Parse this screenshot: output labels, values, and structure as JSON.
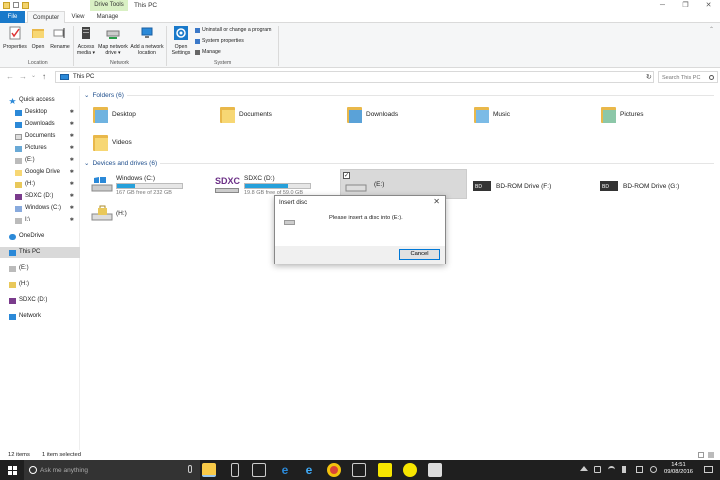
{
  "window": {
    "context_tab": "Drive Tools",
    "title": "This PC"
  },
  "ribbon_tabs": {
    "file": "File",
    "computer": "Computer",
    "view": "View",
    "manage": "Manage"
  },
  "ribbon": {
    "location": {
      "label": "Location",
      "properties": "Properties",
      "open": "Open",
      "rename": "Rename"
    },
    "network": {
      "label": "Network",
      "access_media_1": "Access",
      "access_media_2": "media ▾",
      "map_drive_1": "Map network",
      "map_drive_2": "drive ▾",
      "add_location_1": "Add a network",
      "add_location_2": "location"
    },
    "system": {
      "label": "System",
      "open_settings_1": "Open",
      "open_settings_2": "Settings",
      "uninstall": "Uninstall or change a program",
      "sys_props": "System properties",
      "manage": "Manage"
    }
  },
  "address": {
    "back": "←",
    "forward": "→",
    "recent": "⌄",
    "up": "↑",
    "path": "This PC",
    "refresh": "↻",
    "search_placeholder": "Search This PC"
  },
  "sidebar": {
    "items": [
      {
        "label": "Quick access",
        "pin": ""
      },
      {
        "label": "Desktop",
        "pin": "✱"
      },
      {
        "label": "Downloads",
        "pin": "✱"
      },
      {
        "label": "Documents",
        "pin": "✱"
      },
      {
        "label": "Pictures",
        "pin": "✱"
      },
      {
        "label": "(E:)",
        "pin": "✱"
      },
      {
        "label": "Google Drive",
        "pin": "✱"
      },
      {
        "label": "(H:)",
        "pin": "✱"
      },
      {
        "label": "SDXC (D:)",
        "pin": "✱"
      },
      {
        "label": "Windows (C:)",
        "pin": "✱"
      },
      {
        "label": "I:\\",
        "pin": "✱"
      },
      {
        "label": "OneDrive",
        "pin": ""
      },
      {
        "label": "This PC",
        "pin": ""
      },
      {
        "label": "(E:)",
        "pin": ""
      },
      {
        "label": "(H:)",
        "pin": ""
      },
      {
        "label": "SDXC (D:)",
        "pin": ""
      },
      {
        "label": "Network",
        "pin": ""
      }
    ]
  },
  "folders": {
    "header": "Folders (6)",
    "items": [
      "Desktop",
      "Documents",
      "Downloads",
      "Music",
      "Pictures",
      "Videos"
    ]
  },
  "drives": {
    "header": "Devices and drives (6)",
    "sdxc_logo": "SDXC",
    "items": [
      {
        "label": "Windows (C:)",
        "free": "167 GB free of 232 GB",
        "used_fraction": 0.28
      },
      {
        "label": "SDXC (D:)",
        "free": "19.8 GB free of 59.0 GB",
        "used_fraction": 0.66
      },
      {
        "label": "(E:)"
      },
      {
        "label": "BD-ROM Drive (F:)"
      },
      {
        "label": "BD-ROM Drive (G:)"
      },
      {
        "label": "(H:)"
      }
    ],
    "checkbox": "✓"
  },
  "dialog": {
    "title": "Insert disc",
    "close": "✕",
    "message": "Please insert a disc into  (E:).",
    "cancel": "Cancel"
  },
  "status": {
    "count": "12 items",
    "selected": "1 item selected"
  },
  "taskbar": {
    "search_placeholder": "Ask me anything",
    "time": "14:51",
    "date": "09/08/2016"
  },
  "colors": {
    "accent": "#1979ca",
    "bar_fill": "#26a0da",
    "folder": "#e9b84a",
    "selection": "#d9d9d9",
    "taskbar": "#1f1f1f"
  }
}
